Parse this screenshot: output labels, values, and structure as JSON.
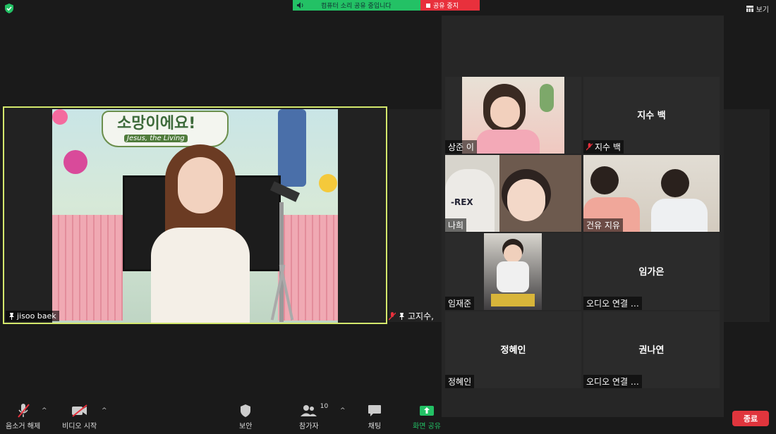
{
  "share_banner": {
    "audio_label": "컴퓨터 소리 공유 중입니다",
    "stop_label": "공유 중지"
  },
  "view_button": {
    "label": "보기"
  },
  "main_speaker": {
    "name": "jisoo baek",
    "banner_title": "소망이에요!",
    "banner_subtitle": "Jesus, the Living"
  },
  "partial_participant": {
    "name": "고지수,"
  },
  "gallery": {
    "tiles": [
      {
        "name": "상준 이",
        "center": ""
      },
      {
        "name": "지수 백",
        "center": "지수 백"
      },
      {
        "name": "나희",
        "center": ""
      },
      {
        "name": "건유 지유",
        "center": ""
      },
      {
        "name": "임재준",
        "center": ""
      },
      {
        "name": "오디오 연결 …",
        "center": "임가은"
      },
      {
        "name": "정혜인",
        "center": "정혜인"
      },
      {
        "name": "오디오 연결 …",
        "center": "권나연"
      }
    ]
  },
  "toolbar": {
    "unmute": "음소거 해제",
    "start_video": "비디오 시작",
    "security": "보안",
    "participants": "참가자",
    "participants_count": "10",
    "chat": "채팅",
    "share_screen": "화면 공유",
    "end": "종료"
  },
  "colors": {
    "accent_green": "#23c165",
    "stop_red": "#e8303c",
    "speaker_border": "#d4e86c"
  }
}
